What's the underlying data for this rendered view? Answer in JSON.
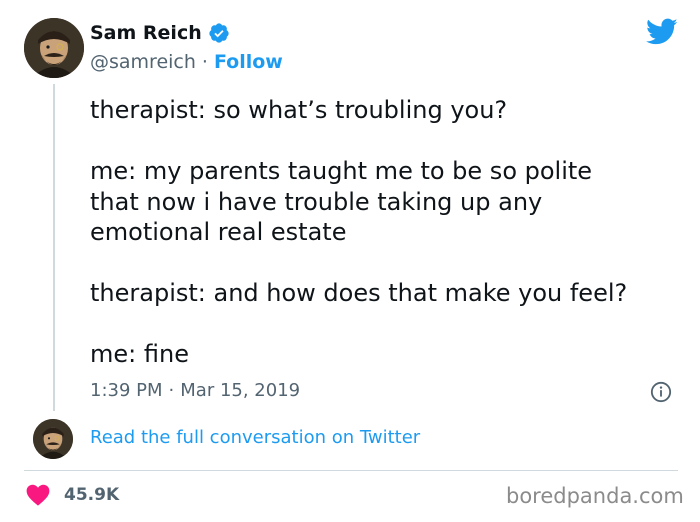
{
  "tweet": {
    "author": {
      "name": "Sam Reich",
      "handle": "@samreich",
      "separator": "·",
      "follow_label": "Follow"
    },
    "text_lines": {
      "line1": "therapist: so what’s troubling you?",
      "line2": "me: my parents taught me to be so polite",
      "line3": "that now i have trouble taking up any",
      "line4": "emotional real estate",
      "line5": "therapist: and how does that make you feel?",
      "line6": "me: fine"
    },
    "time": "1:39 PM",
    "time_separator": "·",
    "date": "Mar 15, 2019",
    "read_more_label": "Read the full conversation on Twitter",
    "like_count": "45.9K"
  },
  "icons": {
    "verified": "verified-badge-icon",
    "twitter": "twitter-bird-icon",
    "info": "info-icon",
    "heart": "heart-icon"
  },
  "colors": {
    "accent_blue": "#1d9bf0",
    "text_primary": "#0f1419",
    "text_secondary": "#536471",
    "heart_pink": "#f91880",
    "divider": "#cfd9de"
  },
  "watermark": "boredpanda.com"
}
